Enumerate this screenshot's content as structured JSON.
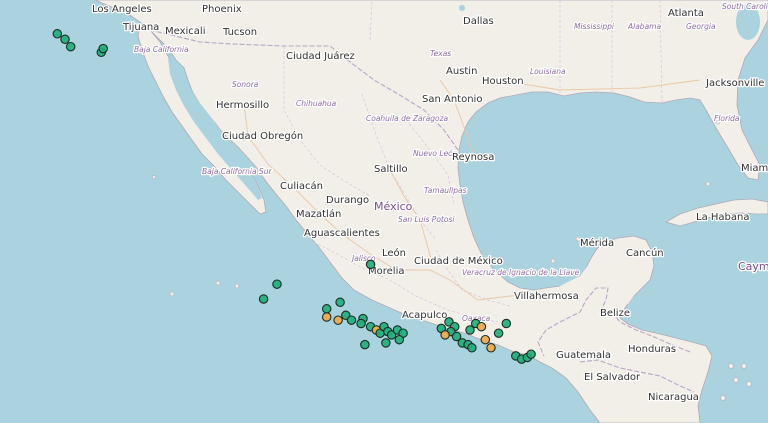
{
  "map": {
    "cities": [
      "Los Angeles",
      "Phoenix",
      "Mexicali",
      "Tijuana",
      "Tucson",
      "Dallas",
      "Atlanta",
      "Ciudad Juárez",
      "Austin",
      "Houston",
      "San Antonio",
      "Jacksonville",
      "Hermosillo",
      "Ciudad Obregón",
      "Reynosa",
      "Culiacán",
      "Saltillo",
      "Miami",
      "Durango",
      "Mazatlán",
      "La Habana",
      "Mérida",
      "Cancún",
      "Aguascalientes",
      "León",
      "Morelia",
      "Ciudad de México",
      "Villahermosa",
      "Belize",
      "Guatemala",
      "Honduras",
      "El Salvador",
      "Nicaragua",
      "Acapulco"
    ],
    "countries": [
      "México",
      "Cayman Islands"
    ],
    "regions": [
      "South Carolina",
      "Mississippi",
      "Alabama",
      "Georgia",
      "Texas",
      "Louisiana",
      "Florida",
      "Baja California",
      "Sonora",
      "Chihuahua",
      "Coahuila de Zaragoza",
      "Nuevo León",
      "Tamaulipas",
      "Baja California Sur",
      "San Luis Potosí",
      "Jalisco",
      "Veracruz de Ignacio de la Llave",
      "Oaxaca"
    ],
    "marker_legend": {
      "green": "#1fae7c",
      "orange": "#f0a94a"
    },
    "markers": [
      {
        "lat": 32.6,
        "lon": -115.5,
        "kind": "green"
      },
      {
        "lat": 32.3,
        "lon": -115.1,
        "kind": "green"
      },
      {
        "lat": 31.9,
        "lon": -114.8,
        "kind": "green"
      },
      {
        "lat": 31.6,
        "lon": -113.2,
        "kind": "green"
      },
      {
        "lat": 31.8,
        "lon": -113.1,
        "kind": "green"
      },
      {
        "lat": 19.4,
        "lon": -99.1,
        "kind": "green"
      },
      {
        "lat": 18.2,
        "lon": -104.0,
        "kind": "green"
      },
      {
        "lat": 17.3,
        "lon": -104.7,
        "kind": "green"
      },
      {
        "lat": 16.7,
        "lon": -101.4,
        "kind": "green"
      },
      {
        "lat": 17.1,
        "lon": -100.7,
        "kind": "green"
      },
      {
        "lat": 16.2,
        "lon": -101.4,
        "kind": "orange"
      },
      {
        "lat": 16.0,
        "lon": -100.8,
        "kind": "orange"
      },
      {
        "lat": 16.3,
        "lon": -100.4,
        "kind": "green"
      },
      {
        "lat": 16.0,
        "lon": -100.1,
        "kind": "green"
      },
      {
        "lat": 16.1,
        "lon": -99.5,
        "kind": "green"
      },
      {
        "lat": 15.8,
        "lon": -99.6,
        "kind": "green"
      },
      {
        "lat": 15.6,
        "lon": -99.1,
        "kind": "green"
      },
      {
        "lat": 15.4,
        "lon": -98.8,
        "kind": "orange"
      },
      {
        "lat": 15.2,
        "lon": -98.6,
        "kind": "green"
      },
      {
        "lat": 15.6,
        "lon": -98.4,
        "kind": "green"
      },
      {
        "lat": 15.3,
        "lon": -98.2,
        "kind": "green"
      },
      {
        "lat": 15.1,
        "lon": -98.0,
        "kind": "green"
      },
      {
        "lat": 15.4,
        "lon": -97.7,
        "kind": "green"
      },
      {
        "lat": 15.2,
        "lon": -97.4,
        "kind": "green"
      },
      {
        "lat": 14.8,
        "lon": -97.6,
        "kind": "green"
      },
      {
        "lat": 14.6,
        "lon": -98.3,
        "kind": "green"
      },
      {
        "lat": 14.5,
        "lon": -99.4,
        "kind": "green"
      },
      {
        "lat": 15.5,
        "lon": -95.4,
        "kind": "green"
      },
      {
        "lat": 15.9,
        "lon": -95.0,
        "kind": "green"
      },
      {
        "lat": 15.6,
        "lon": -94.7,
        "kind": "green"
      },
      {
        "lat": 15.3,
        "lon": -94.9,
        "kind": "green"
      },
      {
        "lat": 15.1,
        "lon": -95.2,
        "kind": "orange"
      },
      {
        "lat": 15.0,
        "lon": -94.6,
        "kind": "green"
      },
      {
        "lat": 14.6,
        "lon": -94.3,
        "kind": "green"
      },
      {
        "lat": 14.5,
        "lon": -94.0,
        "kind": "green"
      },
      {
        "lat": 14.3,
        "lon": -93.8,
        "kind": "green"
      },
      {
        "lat": 15.4,
        "lon": -93.9,
        "kind": "green"
      },
      {
        "lat": 15.8,
        "lon": -93.6,
        "kind": "green"
      },
      {
        "lat": 15.6,
        "lon": -93.3,
        "kind": "orange"
      },
      {
        "lat": 14.8,
        "lon": -93.1,
        "kind": "orange"
      },
      {
        "lat": 14.3,
        "lon": -92.8,
        "kind": "orange"
      },
      {
        "lat": 15.2,
        "lon": -92.4,
        "kind": "green"
      },
      {
        "lat": 15.8,
        "lon": -92.0,
        "kind": "green"
      },
      {
        "lat": 13.8,
        "lon": -91.5,
        "kind": "green"
      },
      {
        "lat": 13.6,
        "lon": -91.2,
        "kind": "green"
      },
      {
        "lat": 13.7,
        "lon": -90.9,
        "kind": "green"
      },
      {
        "lat": 13.9,
        "lon": -90.7,
        "kind": "green"
      }
    ]
  }
}
